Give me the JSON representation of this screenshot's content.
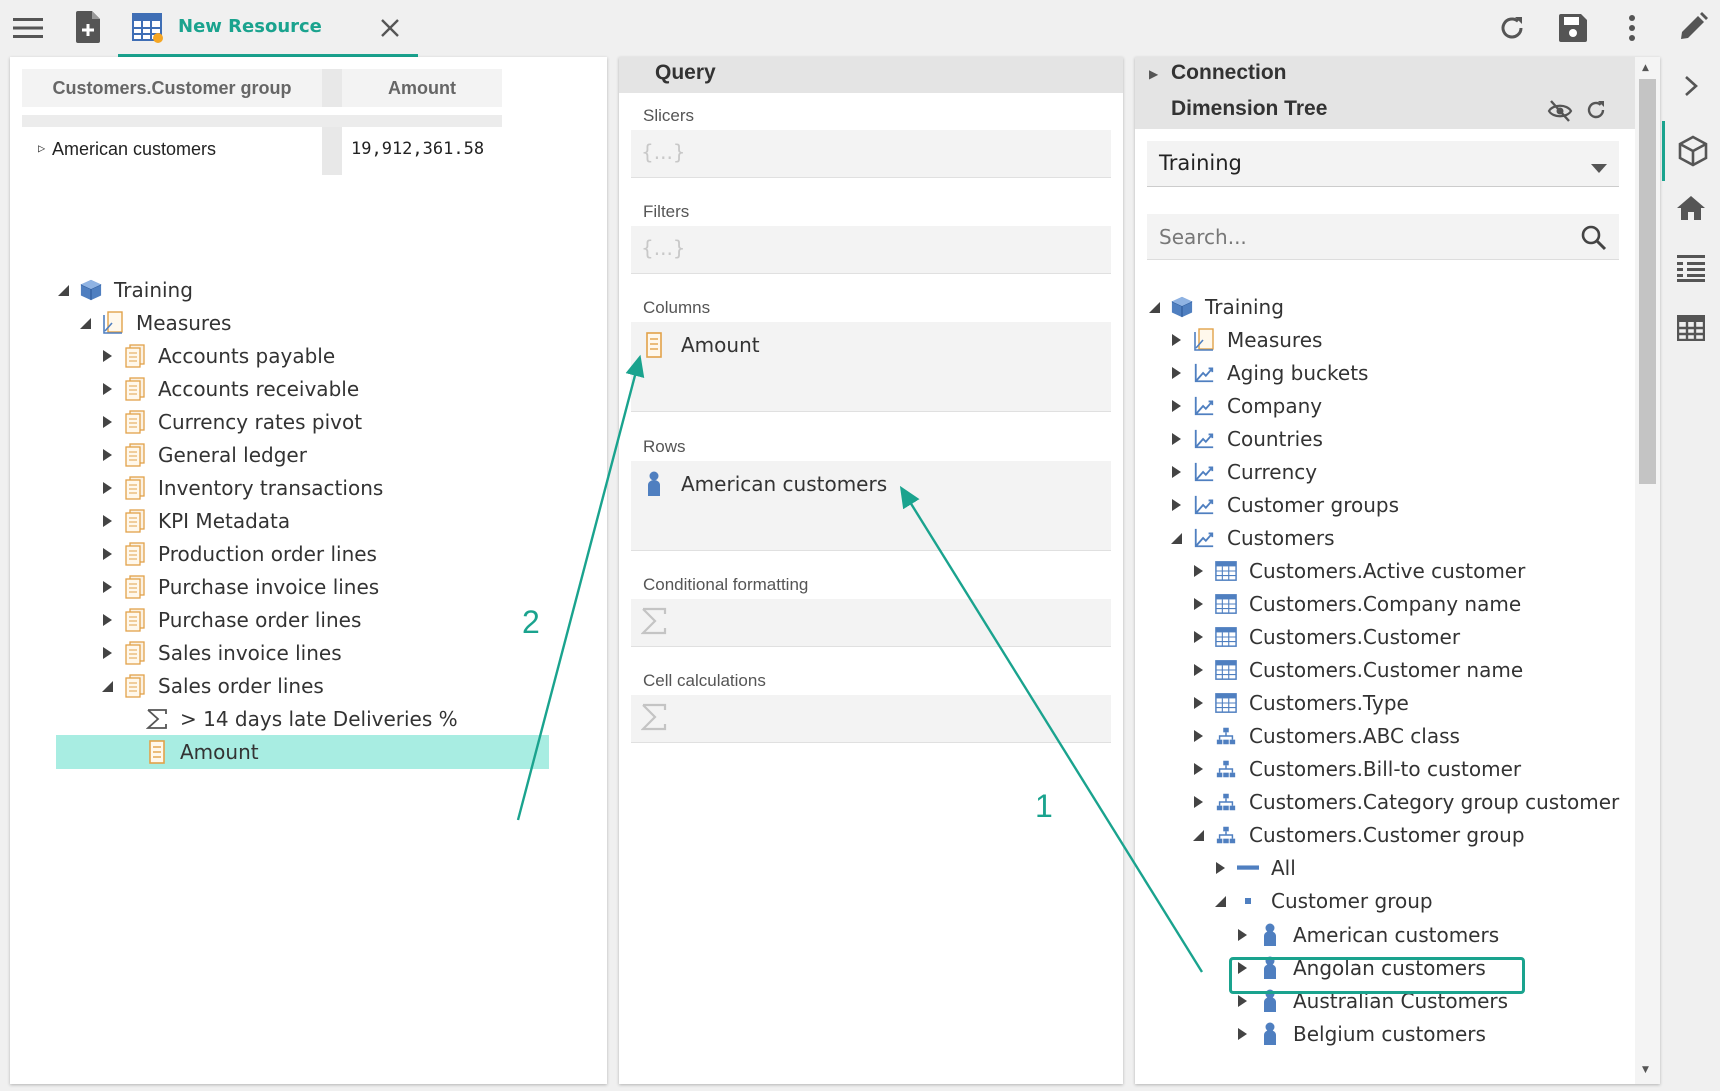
{
  "topbar": {
    "icons": [
      "menu-icon",
      "new-document-icon",
      "table-icon",
      "refresh-icon",
      "save-icon",
      "more-vert-icon",
      "edit-icon"
    ],
    "tab_title": "New Resource",
    "colors": {
      "accent": "#1aa38e",
      "badge": "#f5a623"
    }
  },
  "result": {
    "grid": {
      "headers": [
        "Customers.Customer group",
        "Amount"
      ],
      "rows": [
        {
          "label": "American customers",
          "value": "19,912,361.58"
        }
      ]
    },
    "tree": [
      {
        "label": "Training",
        "icon": "cube-icon",
        "expanded": true
      },
      {
        "label": "Measures",
        "icon": "measures-icon",
        "expanded": true
      },
      {
        "label": "Accounts payable",
        "icon": "measure-group-icon"
      },
      {
        "label": "Accounts receivable",
        "icon": "measure-group-icon"
      },
      {
        "label": "Currency rates pivot",
        "icon": "measure-group-icon"
      },
      {
        "label": "General ledger",
        "icon": "measure-group-icon"
      },
      {
        "label": "Inventory transactions",
        "icon": "measure-group-icon"
      },
      {
        "label": "KPI Metadata",
        "icon": "measure-group-icon"
      },
      {
        "label": "Production order lines",
        "icon": "measure-group-icon"
      },
      {
        "label": "Purchase invoice lines",
        "icon": "measure-group-icon"
      },
      {
        "label": "Purchase order lines",
        "icon": "measure-group-icon"
      },
      {
        "label": "Sales invoice lines",
        "icon": "measure-group-icon"
      },
      {
        "label": "Sales order lines",
        "icon": "measure-group-icon",
        "expanded": true
      },
      {
        "label": "> 14 days late Deliveries %",
        "icon": "sigma-icon"
      },
      {
        "label": "Amount",
        "icon": "measure-icon",
        "selected": true
      }
    ]
  },
  "query": {
    "title": "Query",
    "sections": {
      "slicers": {
        "label": "Slicers",
        "placeholder": "{...}"
      },
      "filters": {
        "label": "Filters",
        "placeholder": "{...}"
      },
      "columns": {
        "label": "Columns",
        "item": "Amount"
      },
      "rows": {
        "label": "Rows",
        "item": "American customers"
      },
      "conditional": {
        "label": "Conditional formatting"
      },
      "calculations": {
        "label": "Cell calculations"
      }
    }
  },
  "dimension": {
    "connection_label": "Connection",
    "tree_title": "Dimension Tree",
    "schema_selected": "Training",
    "search_placeholder": "Search...",
    "tree": [
      {
        "label": "Training",
        "icon": "cube-icon"
      },
      {
        "label": "Measures",
        "icon": "measures-icon"
      },
      {
        "label": "Aging buckets",
        "icon": "dimension-icon"
      },
      {
        "label": "Company",
        "icon": "dimension-icon"
      },
      {
        "label": "Countries",
        "icon": "dimension-icon"
      },
      {
        "label": "Currency",
        "icon": "dimension-icon"
      },
      {
        "label": "Customer groups",
        "icon": "dimension-icon"
      },
      {
        "label": "Customers",
        "icon": "dimension-icon"
      },
      {
        "label": "Customers.Active customer",
        "icon": "level-table-icon"
      },
      {
        "label": "Customers.Company name",
        "icon": "level-table-icon"
      },
      {
        "label": "Customers.Customer",
        "icon": "level-table-icon"
      },
      {
        "label": "Customers.Customer name",
        "icon": "level-table-icon"
      },
      {
        "label": "Customers.Type",
        "icon": "level-table-icon"
      },
      {
        "label": "Customers.ABC class",
        "icon": "hierarchy-icon"
      },
      {
        "label": "Customers.Bill-to customer",
        "icon": "hierarchy-icon"
      },
      {
        "label": "Customers.Category group customer",
        "icon": "hierarchy-icon"
      },
      {
        "label": "Customers.Customer group",
        "icon": "hierarchy-icon"
      },
      {
        "label": "All",
        "icon": "all-level-icon"
      },
      {
        "label": "Customer group",
        "icon": "level-dot-icon"
      },
      {
        "label": "American customers",
        "icon": "member-icon",
        "highlighted": true
      },
      {
        "label": "Angolan customers",
        "icon": "member-icon"
      },
      {
        "label": "Australian Customers",
        "icon": "member-icon"
      },
      {
        "label": "Belgium customers",
        "icon": "member-icon"
      }
    ]
  },
  "rail": {
    "icons": [
      "chevron-right-icon",
      "cube-outline-icon",
      "home-icon",
      "list-icon",
      "grid-icon"
    ]
  },
  "annotations": {
    "step1": "1",
    "step2": "2"
  }
}
